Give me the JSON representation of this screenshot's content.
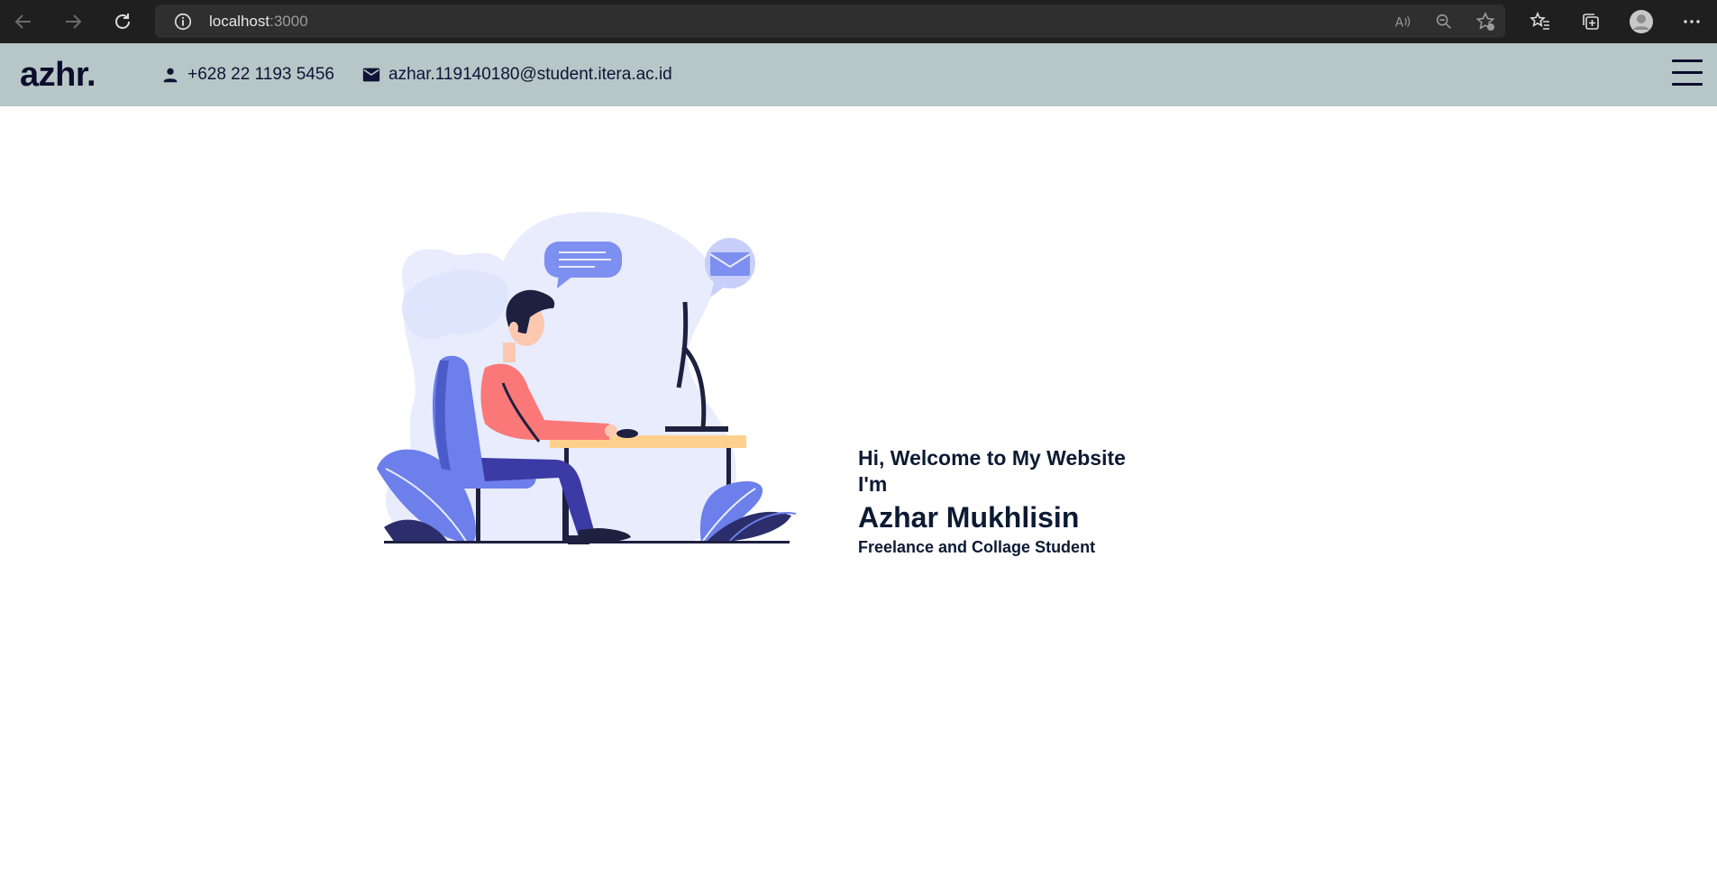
{
  "browser": {
    "url_host": "localhost",
    "url_port": ":3000"
  },
  "header": {
    "brand": "azhr.",
    "phone": "+628 22 1193 5456",
    "email": "azhar.119140180@student.itera.ac.id"
  },
  "hero": {
    "greeting": "Hi, Welcome to My Website",
    "intro": "I'm",
    "name": "Azhar Mukhlisin",
    "role": "Freelance and Collage Student"
  },
  "icons": [
    "back-icon",
    "forward-icon",
    "refresh-icon",
    "info-icon",
    "read-aloud-icon",
    "zoom-icon",
    "add-favorite-icon",
    "favorites-icon",
    "collections-icon",
    "profile-icon",
    "more-icon",
    "person-icon",
    "mail-icon",
    "hamburger-menu-icon"
  ],
  "colors": {
    "header_bg": "#b7c7c7",
    "brand_text": "#0c0c2d",
    "accent_blue": "#6c7fea",
    "shirt": "#fb7878",
    "blob": "#e8ecfd"
  }
}
